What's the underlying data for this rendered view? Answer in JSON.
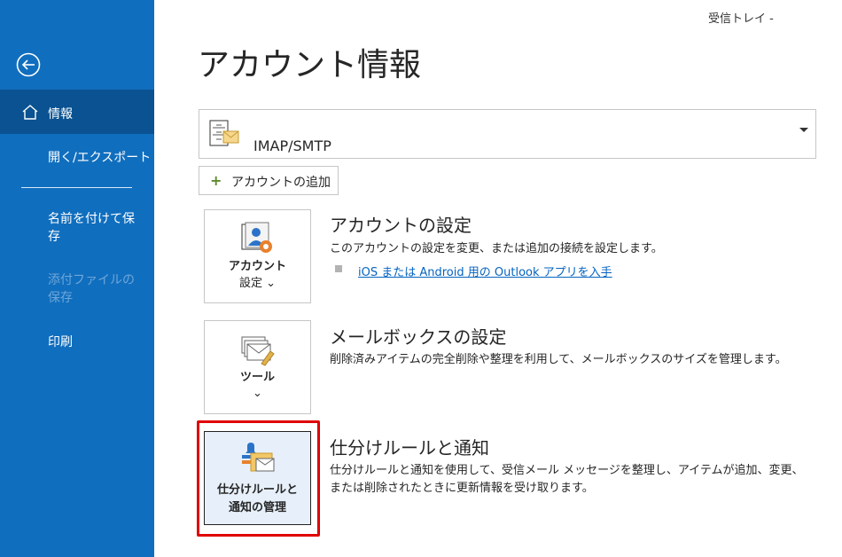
{
  "window": {
    "title": "受信トレイ -"
  },
  "sidebar": {
    "items": [
      {
        "label": "情報"
      },
      {
        "label": "開く/エクスポート"
      },
      {
        "label": "名前を付けて保存"
      },
      {
        "label": "添付ファイルの保存"
      },
      {
        "label": "印刷"
      }
    ]
  },
  "main": {
    "title": "アカウント情報",
    "account": {
      "value": "IMAP/SMTP"
    },
    "add_account_label": "アカウントの追加",
    "sections": [
      {
        "tile_label_1": "アカウント",
        "tile_label_2": "設定 ⌄",
        "title": "アカウントの設定",
        "description": "このアカウントの設定を変更、または追加の接続を設定します。",
        "link": "iOS または Android 用の Outlook アプリを入手"
      },
      {
        "tile_label_1": "ツール",
        "tile_label_2": "⌄",
        "title": "メールボックスの設定",
        "description": "削除済みアイテムの完全削除や整理を利用して、メールボックスのサイズを管理します。"
      },
      {
        "tile_label_1": "仕分けルールと",
        "tile_label_2": "通知の管理",
        "title": "仕分けルールと通知",
        "description": "仕分けルールと通知を使用して、受信メール メッセージを整理し、アイテムが追加、変更、または削除されたときに更新情報を受け取ります。"
      }
    ]
  },
  "colors": {
    "sidebar": "#106ebe",
    "sidebar_active": "#0a5291",
    "link": "#0563c1",
    "highlight": "#e00000"
  }
}
